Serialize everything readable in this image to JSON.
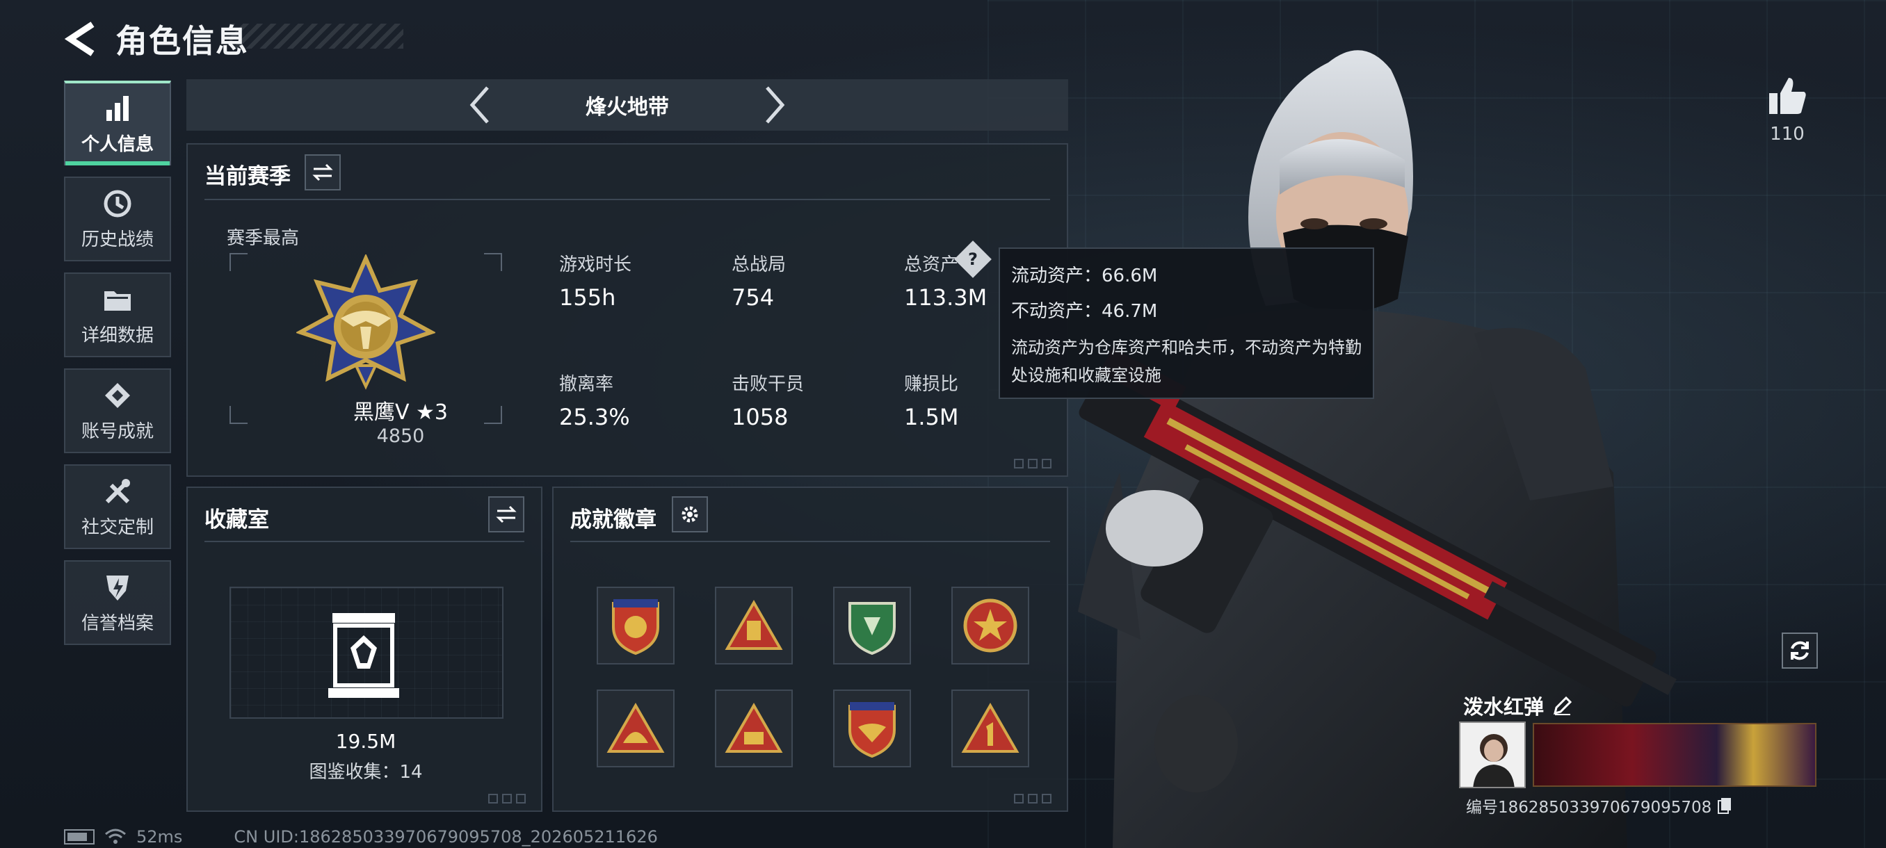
{
  "header": {
    "title": "角色信息"
  },
  "sidebar": {
    "items": [
      {
        "label": "个人信息",
        "icon": "bar-chart-icon",
        "active": true
      },
      {
        "label": "历史战绩",
        "icon": "history-clock-icon",
        "active": false
      },
      {
        "label": "详细数据",
        "icon": "folder-icon",
        "active": false
      },
      {
        "label": "账号成就",
        "icon": "achievement-diamond-icon",
        "active": false
      },
      {
        "label": "社交定制",
        "icon": "tools-icon",
        "active": false
      },
      {
        "label": "信誉档案",
        "icon": "shield-lightning-icon",
        "active": false
      }
    ]
  },
  "mode_selector": {
    "current": "烽火地带"
  },
  "season": {
    "title": "当前赛季",
    "best_label": "赛季最高",
    "rank_name": "黑鹰Ⅴ ★3",
    "rank_score": "4850",
    "stats": [
      {
        "label": "游戏时长",
        "value": "155h"
      },
      {
        "label": "总战局",
        "value": "754"
      },
      {
        "label": "总资产",
        "value": "113.3M"
      },
      {
        "label": "撤离率",
        "value": "25.3%"
      },
      {
        "label": "击败干员",
        "value": "1058"
      },
      {
        "label": "赚损比",
        "value": "1.5M"
      }
    ],
    "help_glyph": "?"
  },
  "tooltip": {
    "liquid": "流动资产：66.6M",
    "fixed": "不动资产：46.7M",
    "description": "流动资产为仓库资产和哈夫币，不动资产为特勤处设施和收藏室设施"
  },
  "collection": {
    "title": "收藏室",
    "value": "19.5M",
    "count": "图鉴收集：14"
  },
  "achievements": {
    "title": "成就徽章",
    "badges": [
      "badge-1",
      "badge-2",
      "badge-3",
      "badge-4",
      "badge-5",
      "badge-6",
      "badge-7",
      "badge-8"
    ]
  },
  "profile": {
    "likes": "110",
    "player_name": "泼水红弹",
    "player_id": "编号1862850339706790957​08"
  },
  "status_bar": {
    "ping": "52ms",
    "uid": "CN UID:1862850339706790957​08_202605211626"
  },
  "colors": {
    "accent": "#4fd3a0",
    "background": "#141a22",
    "panel": "#1e252e"
  }
}
